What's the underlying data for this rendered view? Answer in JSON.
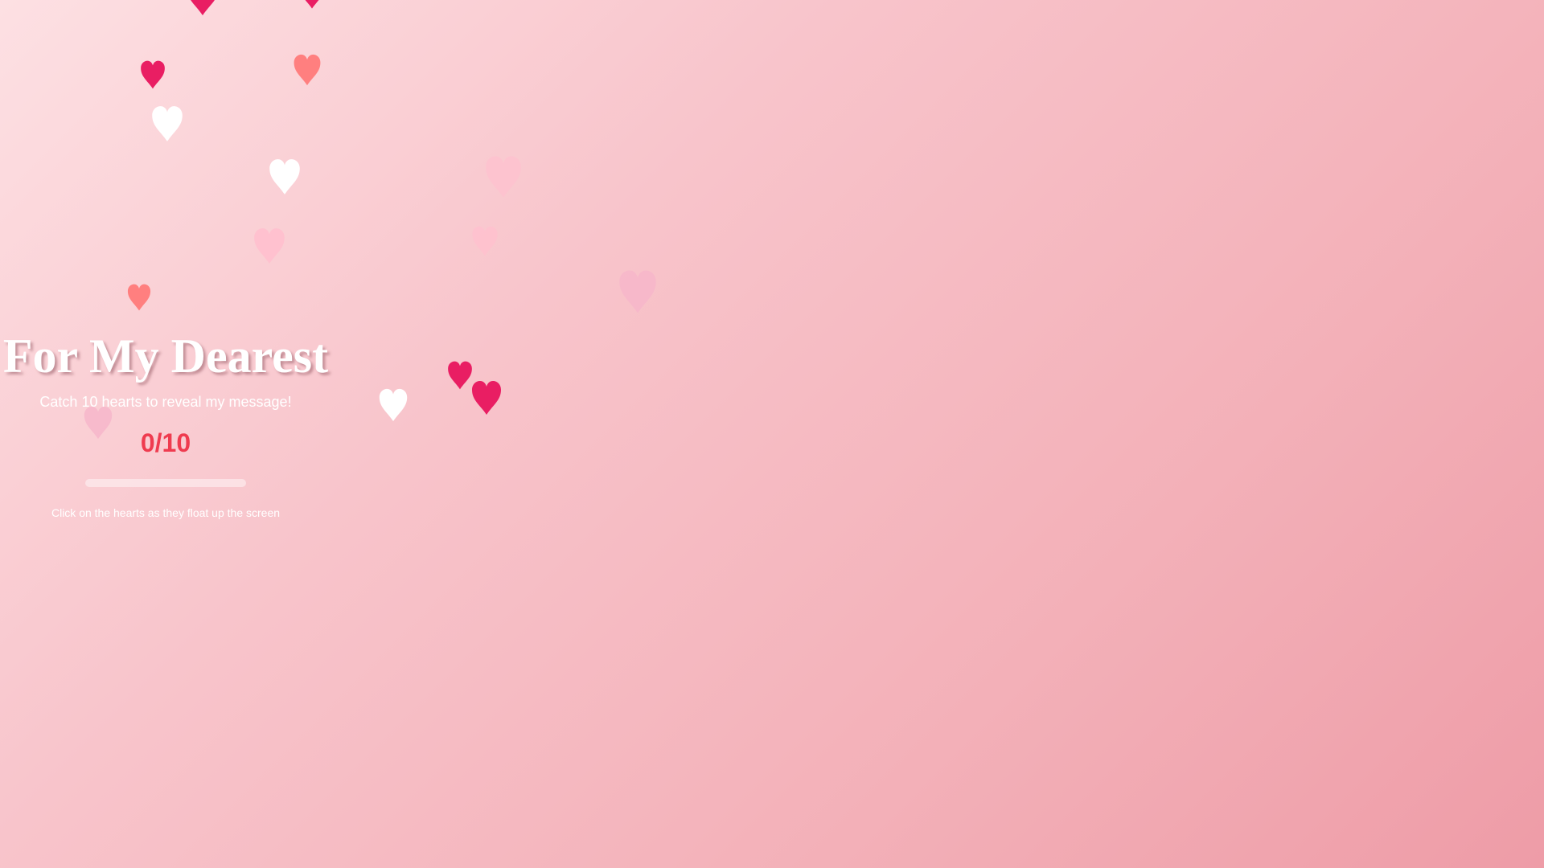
{
  "game": {
    "title": "For My Dearest",
    "subtitle": "Catch 10 hearts to reveal my message!",
    "score": "0/10",
    "progress": 0,
    "hint": "Click on the hearts as they float up the screen"
  },
  "colors": {
    "accent": "#ef3b4f",
    "heart_crimson": "#e91e63",
    "heart_coral": "#ff7f7f",
    "heart_white": "#ffffff",
    "heart_pale_pink": "#ffc1cf"
  },
  "icons": {
    "heart": "heart-icon"
  }
}
